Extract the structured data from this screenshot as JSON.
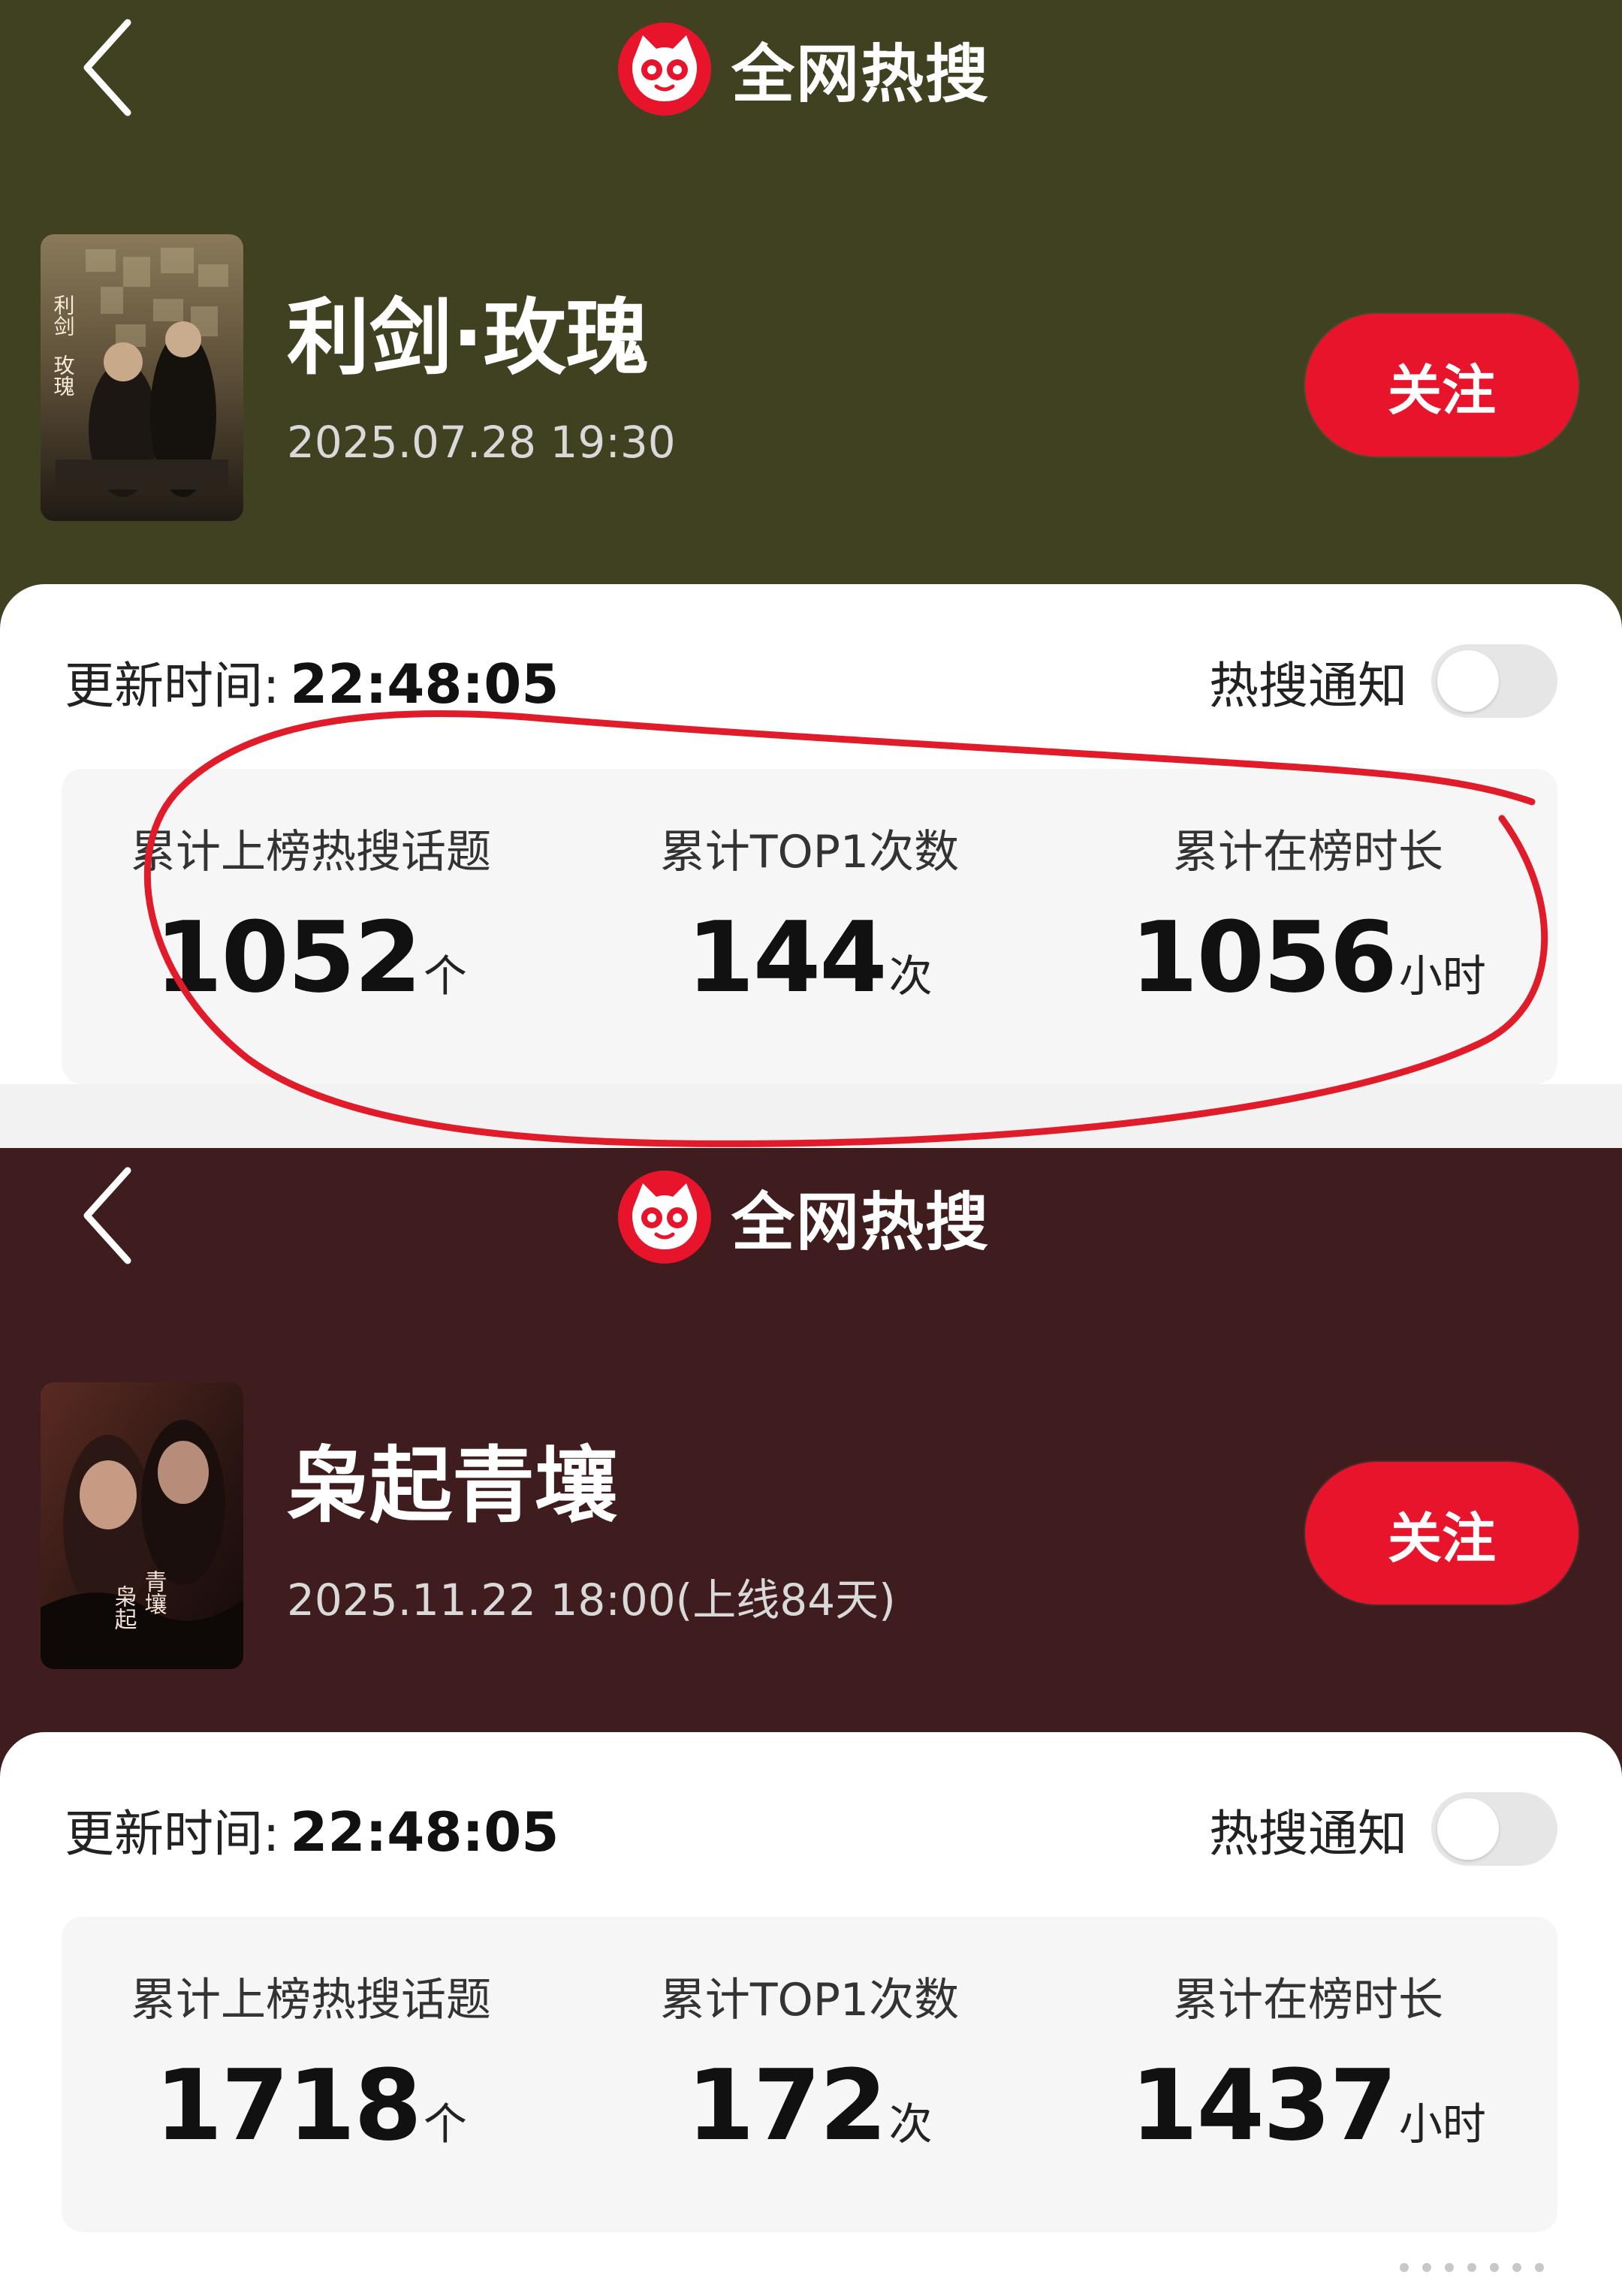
{
  "panels": [
    {
      "header": {
        "back_icon": "chevron-left-icon",
        "logo_icon": "cat-face-logo-icon",
        "title": "全网热搜"
      },
      "show": {
        "poster_text": "利剑·玫瑰",
        "title": "利剑·玫瑰",
        "date": "2025.07.28 19:30",
        "follow_label": "关注"
      },
      "update": {
        "label": "更新时间:",
        "time": "22:48:05"
      },
      "notify": {
        "label": "热搜通知",
        "on": false
      },
      "stats": [
        {
          "label": "累计上榜热搜话题",
          "value": "1052",
          "unit": "个"
        },
        {
          "label": "累计TOP1次数",
          "value": "144",
          "unit": "次"
        },
        {
          "label": "累计在榜时长",
          "value": "1056",
          "unit": "小时"
        }
      ]
    },
    {
      "header": {
        "back_icon": "chevron-left-icon",
        "logo_icon": "cat-face-logo-icon",
        "title": "全网热搜"
      },
      "show": {
        "poster_text": "枭起青壤",
        "title": "枭起青壤",
        "date": "2025.11.22 18:00(上线84天)",
        "follow_label": "关注"
      },
      "update": {
        "label": "更新时间:",
        "time": "22:48:05"
      },
      "notify": {
        "label": "热搜通知",
        "on": false
      },
      "stats": [
        {
          "label": "累计上榜热搜话题",
          "value": "1718",
          "unit": "个"
        },
        {
          "label": "累计TOP1次数",
          "value": "172",
          "unit": "次"
        },
        {
          "label": "累计在榜时长",
          "value": "1437",
          "unit": "小时"
        }
      ]
    }
  ],
  "colors": {
    "panel1_header_bg": "#3f4120",
    "panel2_header_bg": "#3f1d1e",
    "follow_button": "#e8142c",
    "annotation_circle": "#e01c2a"
  },
  "annotation": {
    "type": "hand-drawn-circle",
    "color": "#e01c2a",
    "target": "panel-1-stats"
  }
}
